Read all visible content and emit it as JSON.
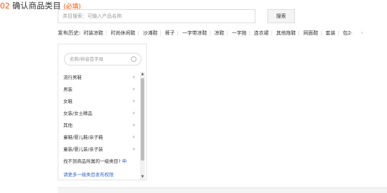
{
  "header": {
    "step_number": "02",
    "title": "确认商品类目",
    "required_note": "(必填)"
  },
  "search": {
    "placeholder": "类目搜索：可输入产品名称",
    "button_label": "搜索"
  },
  "history": {
    "label": "发布历史:",
    "items": [
      "时装凉鞋",
      "时尚休闲鞋",
      "沙滩鞋",
      "裤子",
      "一字带凉鞋",
      "凉鞋",
      "一字拖",
      "连衣裙",
      "其他拖鞋",
      "网面鞋",
      "套装",
      "包2"
    ],
    "prev_icon": "chevron-left-icon",
    "next_icon": "chevron-right-icon"
  },
  "category_panel": {
    "search_placeholder": "名称/拼音首字母",
    "items": [
      {
        "label": "流行男鞋"
      },
      {
        "label": "男装"
      },
      {
        "label": "女鞋"
      },
      {
        "label": "女装/女士精品"
      },
      {
        "label": "其他"
      },
      {
        "label": "童鞋/婴儿鞋/亲子鞋"
      },
      {
        "label": "童装/婴儿装/亲子装"
      }
    ],
    "not_found_text": "找不到商品所属的一级类目?",
    "not_found_link": "申",
    "apply_link": "请更多一级类目发布权限"
  }
}
